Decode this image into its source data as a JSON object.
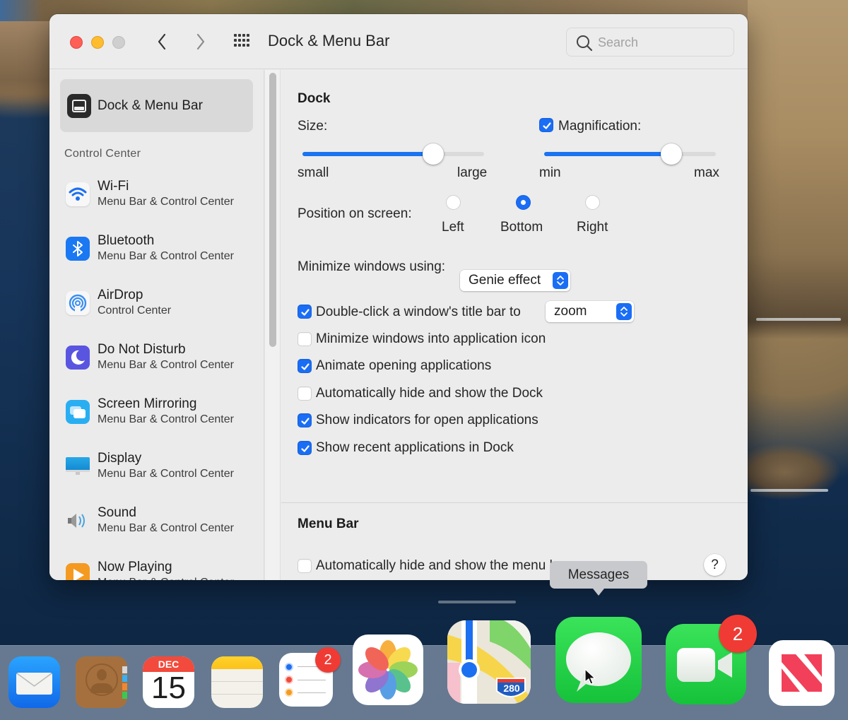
{
  "window": {
    "title": "Dock & Menu Bar",
    "search_placeholder": "Search"
  },
  "sidebar": {
    "selected": {
      "label": "Dock & Menu Bar",
      "icon": "dock-menu-bar-icon"
    },
    "section_label": "Control Center",
    "items": [
      {
        "title": "Wi-Fi",
        "subtitle": "Menu Bar & Control Center",
        "icon": "wifi-icon"
      },
      {
        "title": "Bluetooth",
        "subtitle": "Menu Bar & Control Center",
        "icon": "bluetooth-icon"
      },
      {
        "title": "AirDrop",
        "subtitle": "Control Center",
        "icon": "airdrop-icon"
      },
      {
        "title": "Do Not Disturb",
        "subtitle": "Menu Bar & Control Center",
        "icon": "moon-icon"
      },
      {
        "title": "Screen Mirroring",
        "subtitle": "Menu Bar & Control Center",
        "icon": "screen-mirroring-icon"
      },
      {
        "title": "Display",
        "subtitle": "Menu Bar & Control Center",
        "icon": "display-icon"
      },
      {
        "title": "Sound",
        "subtitle": "Menu Bar & Control Center",
        "icon": "speaker-icon"
      },
      {
        "title": "Now Playing",
        "subtitle": "Menu Bar & Control Center",
        "icon": "play-icon"
      }
    ]
  },
  "dock_section": {
    "heading": "Dock",
    "size": {
      "label": "Size:",
      "min_label": "small",
      "max_label": "large",
      "value_fraction": 0.72
    },
    "magnification": {
      "label": "Magnification:",
      "enabled": true,
      "min_label": "min",
      "max_label": "max",
      "value_fraction": 0.74
    },
    "position": {
      "label": "Position on screen:",
      "options": [
        "Left",
        "Bottom",
        "Right"
      ],
      "selected": "Bottom"
    },
    "minimize_using": {
      "label": "Minimize windows using:",
      "value": "Genie effect"
    },
    "double_click": {
      "label": "Double-click a window's title bar to",
      "checked": true,
      "value": "zoom"
    },
    "checkboxes": [
      {
        "label": "Minimize windows into application icon",
        "checked": false
      },
      {
        "label": "Animate opening applications",
        "checked": true
      },
      {
        "label": "Automatically hide and show the Dock",
        "checked": false
      },
      {
        "label": "Show indicators for open applications",
        "checked": true
      },
      {
        "label": "Show recent applications in Dock",
        "checked": true
      }
    ]
  },
  "menu_bar_section": {
    "heading": "Menu Bar",
    "auto_hide": {
      "label": "Automatically hide and show the menu bar",
      "checked": false
    },
    "help_label": "?"
  },
  "tooltip": {
    "text": "Messages"
  },
  "dock": {
    "apps": [
      {
        "name": "Mail",
        "badge": null
      },
      {
        "name": "Contacts",
        "badge": null
      },
      {
        "name": "Calendar",
        "badge": null,
        "month": "DEC",
        "day": "15"
      },
      {
        "name": "Notes",
        "badge": null
      },
      {
        "name": "Reminders",
        "badge": "2"
      },
      {
        "name": "Photos",
        "badge": null
      },
      {
        "name": "Maps",
        "badge": null,
        "shield": "280"
      },
      {
        "name": "Messages",
        "badge": null
      },
      {
        "name": "FaceTime",
        "badge": "2"
      },
      {
        "name": "News",
        "badge": null
      }
    ]
  },
  "colors": {
    "accent": "#1a6ef5",
    "badge": "#ef3b34",
    "messages_green": "#2bd84a"
  }
}
